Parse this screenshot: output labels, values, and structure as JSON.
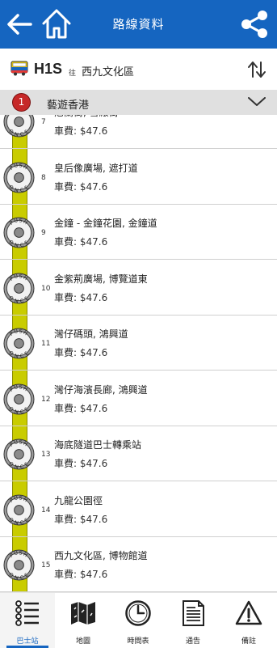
{
  "header": {
    "title": "路線資料"
  },
  "route": {
    "number": "H1S",
    "towards": "往",
    "destination": "西九文化區"
  },
  "tour": {
    "badge": "1",
    "name": "藝遊香港"
  },
  "stops": [
    {
      "number": "7",
      "name": "尼蘭街, 雪廠街",
      "fare": "車費: $47.6"
    },
    {
      "number": "8",
      "name": "皇后像廣場, 遮打道",
      "fare": "車費: $47.6"
    },
    {
      "number": "9",
      "name": "金鐘 - 金鐘花園, 金鐘道",
      "fare": "車費: $47.6"
    },
    {
      "number": "10",
      "name": "金紫荊廣場, 博覽道東",
      "fare": "車費: $47.6"
    },
    {
      "number": "11",
      "name": "灣仔碼頭, 鴻興道",
      "fare": "車費: $47.6"
    },
    {
      "number": "12",
      "name": "灣仔海濱長廊, 鴻興道",
      "fare": "車費: $47.6"
    },
    {
      "number": "13",
      "name": "海底隧道巴士轉乘站",
      "fare": "車費: $47.6"
    },
    {
      "number": "14",
      "name": "九龍公園徑",
      "fare": "車費: $47.6"
    },
    {
      "number": "15",
      "name": "西九文化區, 博物館道",
      "fare": "車費: $47.6"
    }
  ],
  "push_button": {
    "word1": "PUSH",
    "word2": "ONCE"
  },
  "tabs": [
    {
      "label": "巴士站",
      "icon": "bus-stop-list-icon",
      "active": true
    },
    {
      "label": "地圖",
      "icon": "map-icon"
    },
    {
      "label": "時間表",
      "icon": "clock-icon"
    },
    {
      "label": "通告",
      "icon": "notice-document-icon"
    },
    {
      "label": "備註",
      "icon": "warning-icon"
    }
  ],
  "colors": {
    "header": "#1565c0",
    "track": "#c9cc00",
    "badge": "#c62828",
    "tourbar": "#e0e0e0"
  }
}
